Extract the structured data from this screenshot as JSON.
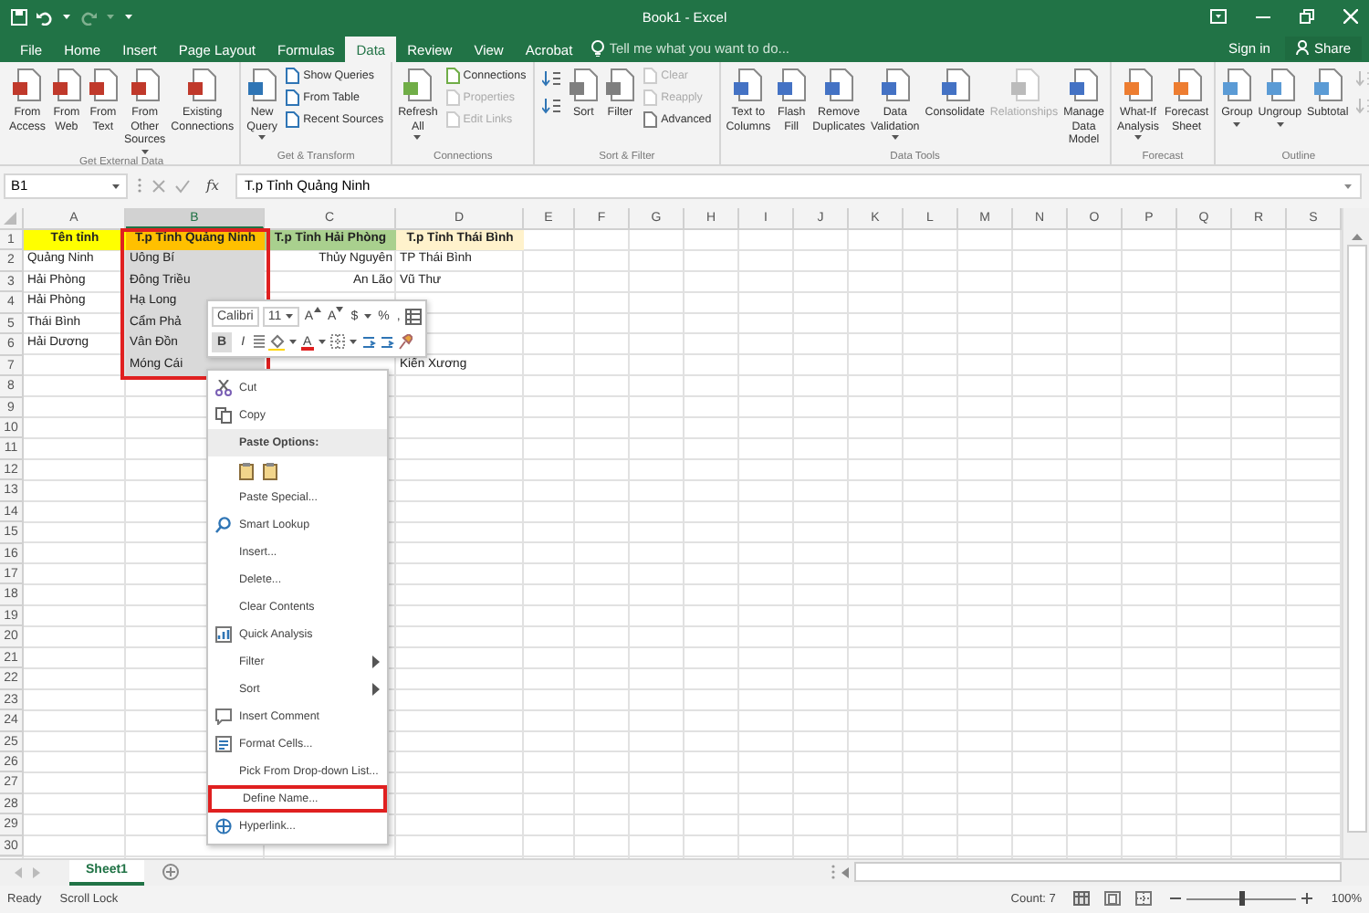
{
  "window": {
    "title": "Book1 - Excel"
  },
  "tabs": [
    {
      "label": "File",
      "selected": false
    },
    {
      "label": "Home",
      "selected": false
    },
    {
      "label": "Insert",
      "selected": false
    },
    {
      "label": "Page Layout",
      "selected": false
    },
    {
      "label": "Formulas",
      "selected": false
    },
    {
      "label": "Data",
      "selected": true
    },
    {
      "label": "Review",
      "selected": false
    },
    {
      "label": "View",
      "selected": false
    },
    {
      "label": "Acrobat",
      "selected": false
    }
  ],
  "tell_me": {
    "placeholder": "Tell me what you want to do..."
  },
  "account": {
    "sign_in": "Sign in",
    "share": "Share"
  },
  "ribbon": {
    "groups": [
      {
        "label": "Get External Data",
        "buttons": [
          {
            "kind": "large",
            "label": "From\nAccess",
            "dropdown": false,
            "disabled": false
          },
          {
            "kind": "large",
            "label": "From\nWeb",
            "dropdown": false,
            "disabled": false
          },
          {
            "kind": "large",
            "label": "From\nText",
            "dropdown": false,
            "disabled": false
          },
          {
            "kind": "large",
            "label": "From Other\nSources",
            "dropdown": true,
            "disabled": false
          },
          {
            "kind": "large",
            "label": "Existing\nConnections",
            "dropdown": false,
            "disabled": false
          }
        ]
      },
      {
        "label": "Get & Transform",
        "buttons": [
          {
            "kind": "large",
            "label": "New\nQuery",
            "dropdown": true,
            "disabled": false
          },
          {
            "kind": "small",
            "label": "Show Queries",
            "dropdown": false,
            "disabled": false
          },
          {
            "kind": "small",
            "label": "From Table",
            "dropdown": false,
            "disabled": false
          },
          {
            "kind": "small",
            "label": "Recent Sources",
            "dropdown": false,
            "disabled": false
          }
        ]
      },
      {
        "label": "Connections",
        "buttons": [
          {
            "kind": "large",
            "label": "Refresh\nAll",
            "dropdown": true,
            "disabled": false
          },
          {
            "kind": "small",
            "label": "Connections",
            "dropdown": false,
            "disabled": false
          },
          {
            "kind": "small",
            "label": "Properties",
            "dropdown": false,
            "disabled": true
          },
          {
            "kind": "small",
            "label": "Edit Links",
            "dropdown": false,
            "disabled": true
          }
        ]
      },
      {
        "label": "Sort & Filter",
        "buttons": [
          {
            "kind": "icon",
            "disabled": false
          },
          {
            "kind": "icon",
            "disabled": false
          },
          {
            "kind": "large",
            "label": "Sort",
            "dropdown": false,
            "disabled": false
          },
          {
            "kind": "large",
            "label": "Filter",
            "dropdown": false,
            "disabled": false
          },
          {
            "kind": "small",
            "label": "Clear",
            "dropdown": false,
            "disabled": true
          },
          {
            "kind": "small",
            "label": "Reapply",
            "dropdown": false,
            "disabled": true
          },
          {
            "kind": "small",
            "label": "Advanced",
            "dropdown": false,
            "disabled": false
          }
        ]
      },
      {
        "label": "Data Tools",
        "buttons": [
          {
            "kind": "large",
            "label": "Text to\nColumns",
            "dropdown": false,
            "disabled": false
          },
          {
            "kind": "large",
            "label": "Flash\nFill",
            "dropdown": false,
            "disabled": false
          },
          {
            "kind": "large",
            "label": "Remove\nDuplicates",
            "dropdown": false,
            "disabled": false
          },
          {
            "kind": "large",
            "label": "Data\nValidation",
            "dropdown": true,
            "disabled": false
          },
          {
            "kind": "large",
            "label": "Consolidate",
            "dropdown": false,
            "disabled": false
          },
          {
            "kind": "large",
            "label": "Relationships",
            "dropdown": false,
            "disabled": true
          },
          {
            "kind": "large",
            "label": "Manage\nData Model",
            "dropdown": false,
            "disabled": false
          }
        ]
      },
      {
        "label": "Forecast",
        "buttons": [
          {
            "kind": "large",
            "label": "What-If\nAnalysis",
            "dropdown": true,
            "disabled": false
          },
          {
            "kind": "large",
            "label": "Forecast\nSheet",
            "dropdown": false,
            "disabled": false
          }
        ]
      },
      {
        "label": "Outline",
        "buttons": [
          {
            "kind": "large",
            "label": "Group",
            "dropdown": true,
            "disabled": false
          },
          {
            "kind": "large",
            "label": "Ungroup",
            "dropdown": true,
            "disabled": false
          },
          {
            "kind": "large",
            "label": "Subtotal",
            "dropdown": false,
            "disabled": false
          },
          {
            "kind": "icon",
            "disabled": true
          },
          {
            "kind": "icon",
            "disabled": true
          }
        ]
      }
    ]
  },
  "formula_bar": {
    "name_box": "B1",
    "fx": "fx",
    "value": "T.p Tỉnh Quảng Ninh"
  },
  "sheet": {
    "outlined": true,
    "columns": [
      {
        "label": "A",
        "selected": false
      },
      {
        "label": "B",
        "selected": true
      },
      {
        "label": "C",
        "selected": false
      },
      {
        "label": "D",
        "selected": false
      },
      {
        "label": "E",
        "selected": false
      },
      {
        "label": "F",
        "selected": false
      },
      {
        "label": "G",
        "selected": false
      },
      {
        "label": "H",
        "selected": false
      },
      {
        "label": "I",
        "selected": false
      },
      {
        "label": "J",
        "selected": false
      },
      {
        "label": "K",
        "selected": false
      },
      {
        "label": "L",
        "selected": false
      },
      {
        "label": "M",
        "selected": false
      },
      {
        "label": "N",
        "selected": false
      },
      {
        "label": "O",
        "selected": false
      },
      {
        "label": "P",
        "selected": false
      },
      {
        "label": "Q",
        "selected": false
      },
      {
        "label": "R",
        "selected": false
      },
      {
        "label": "S",
        "selected": false
      }
    ],
    "row_numbers": [
      "1",
      "2",
      "3",
      "4",
      "5",
      "6",
      "7",
      "8",
      "9",
      "10",
      "11",
      "12",
      "13",
      "14",
      "15",
      "16",
      "17",
      "18",
      "19",
      "20",
      "21",
      "22",
      "23",
      "24",
      "25",
      "26",
      "27",
      "28",
      "29",
      "30"
    ],
    "rows": [
      {
        "cells": [
          {
            "text": "Tên tỉnh",
            "color": "#ffff00"
          },
          {
            "text": "T.p Tỉnh Quảng Ninh",
            "color": "#ffc000"
          },
          {
            "text": "T.p Tỉnh Hải Phòng",
            "color": "#a9d08e"
          },
          {
            "text": "T.p Tỉnh Thái Bình",
            "color": "#fff2cc"
          }
        ]
      },
      {
        "cells": [
          {
            "text": "Quảng Ninh"
          },
          {
            "text": "Uông Bí"
          },
          {
            "text": "Thủy Nguyên"
          },
          {
            "text": "TP Thái Bình"
          }
        ]
      },
      {
        "cells": [
          {
            "text": "Hải Phòng"
          },
          {
            "text": "Đông Triều"
          },
          {
            "text": "An Lão"
          },
          {
            "text": "Vũ Thư"
          }
        ]
      },
      {
        "cells": [
          {
            "text": "Hải Phòng"
          },
          {
            "text": "Hạ Long"
          }
        ]
      },
      {
        "cells": [
          {
            "text": "Thái Bình"
          },
          {
            "text": "Cẩm Phả"
          }
        ]
      },
      {
        "cells": [
          {
            "text": "Hải Dương"
          },
          {
            "text": "Vân Đồn"
          }
        ]
      },
      {
        "cells": [
          null,
          {
            "text": "Móng Cái"
          },
          null,
          {
            "text": "Kiến Xương"
          }
        ]
      }
    ]
  },
  "mini_toolbar": {
    "font": "Calibri",
    "size": "11",
    "row1": [
      {
        "kind": "grow",
        "label": "A"
      },
      {
        "kind": "shrink",
        "label": "A"
      },
      {
        "kind": "text",
        "label": "$"
      },
      {
        "kind": "caret"
      },
      {
        "kind": "text",
        "label": "%"
      },
      {
        "kind": "text",
        "label": ","
      },
      {
        "kind": "table"
      }
    ],
    "row2": [
      {
        "kind": "bold",
        "label": "B"
      },
      {
        "kind": "italic",
        "label": "I"
      },
      {
        "kind": "align"
      },
      {
        "kind": "fill"
      },
      {
        "kind": "caret"
      },
      {
        "kind": "font-color",
        "label": "A"
      },
      {
        "kind": "caret"
      },
      {
        "kind": "borders"
      },
      {
        "kind": "caret"
      },
      {
        "kind": "decimal"
      },
      {
        "kind": "decimal"
      },
      {
        "kind": "brush"
      }
    ]
  },
  "context_menu": {
    "items": [
      {
        "kind": "cut",
        "label": "Cut",
        "submenu": false,
        "outlined": false
      },
      {
        "kind": "copy",
        "label": "Copy",
        "submenu": false,
        "outlined": false
      },
      {
        "kind": "header",
        "label": "Paste Options:"
      },
      {
        "kind": "paste-icons"
      },
      {
        "kind": "plain",
        "label": "Paste Special...",
        "submenu": false,
        "outlined": false
      },
      {
        "kind": "lookup",
        "label": "Smart Lookup",
        "submenu": false,
        "outlined": false
      },
      {
        "kind": "plain",
        "label": "Insert...",
        "submenu": false,
        "outlined": false
      },
      {
        "kind": "plain",
        "label": "Delete...",
        "submenu": false,
        "outlined": false
      },
      {
        "kind": "plain",
        "label": "Clear Contents",
        "submenu": false,
        "outlined": false
      },
      {
        "kind": "analysis",
        "label": "Quick Analysis",
        "submenu": false,
        "outlined": false
      },
      {
        "kind": "plain",
        "label": "Filter",
        "submenu": true,
        "outlined": false
      },
      {
        "kind": "plain",
        "label": "Sort",
        "submenu": true,
        "outlined": false
      },
      {
        "kind": "comment",
        "label": "Insert Comment",
        "submenu": false,
        "outlined": false
      },
      {
        "kind": "format",
        "label": "Format Cells...",
        "submenu": false,
        "outlined": false
      },
      {
        "kind": "plain",
        "label": "Pick From Drop-down List...",
        "submenu": false,
        "outlined": false
      },
      {
        "kind": "plain",
        "label": "Define Name...",
        "submenu": false,
        "outlined": true
      },
      {
        "kind": "link",
        "label": "Hyperlink...",
        "submenu": false,
        "outlined": false
      }
    ]
  },
  "sheet_tabs": [
    {
      "label": "Sheet1",
      "selected": true
    }
  ],
  "status_bar": {
    "mode": "Ready",
    "scroll_lock": "Scroll Lock",
    "count": "Count: 7",
    "zoom": {
      "level": 0.5,
      "reading": "100%"
    }
  }
}
